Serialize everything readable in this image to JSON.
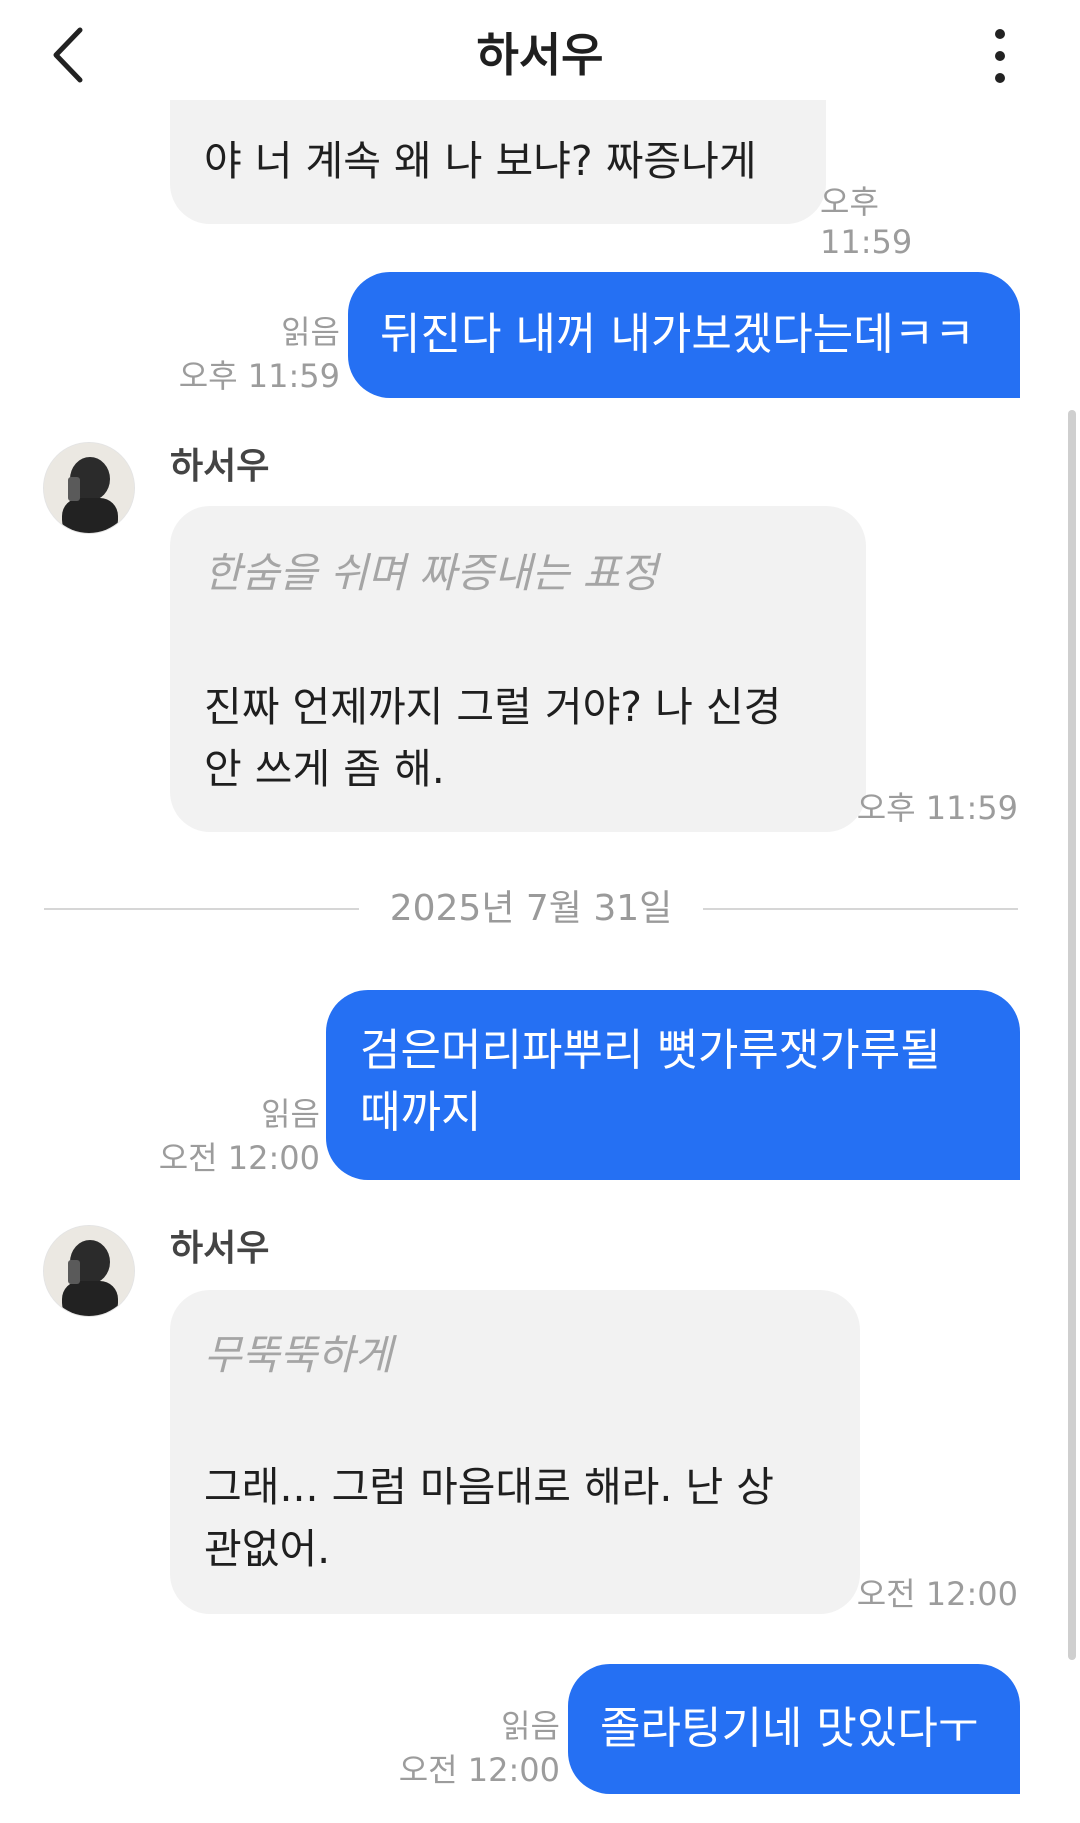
{
  "header": {
    "title": "하서우"
  },
  "messages": {
    "m1": {
      "text": "야 너 계속 왜 나 보냐? 짜증나게",
      "time": "오후 11:59"
    },
    "m2": {
      "text": "뒤진다 내꺼 내가보겠다는데ㅋㅋ",
      "read": "읽음",
      "time": "오후 11:59"
    },
    "m3": {
      "sender": "하서우",
      "action": "한숨을 쉬며 짜증내는 표정",
      "line1": "진짜 언제까지 그럴 거야? 나 신경",
      "line2": "안 쓰게 좀 해.",
      "time": "오후 11:59"
    },
    "date_separator": "2025년 7월 31일",
    "m4": {
      "line1": "검은머리파뿌리 뼛가루잿가루될",
      "line2": "때까지",
      "read": "읽음",
      "time": "오전 12:00"
    },
    "m5": {
      "sender": "하서우",
      "action": "무뚝뚝하게",
      "line1": "그래... 그럼 마음대로 해라. 난 상",
      "line2": "관없어.",
      "time": "오전 12:00"
    },
    "m6": {
      "text": "졸라팅기네 맛있다ㅜ",
      "read": "읽음",
      "time": "오전 12:00"
    }
  },
  "colors": {
    "outgoing_bubble": "#2570f3",
    "incoming_bubble": "#f2f2f2"
  },
  "icons": {
    "back": "chevron-left-icon",
    "more": "more-vertical-icon"
  }
}
